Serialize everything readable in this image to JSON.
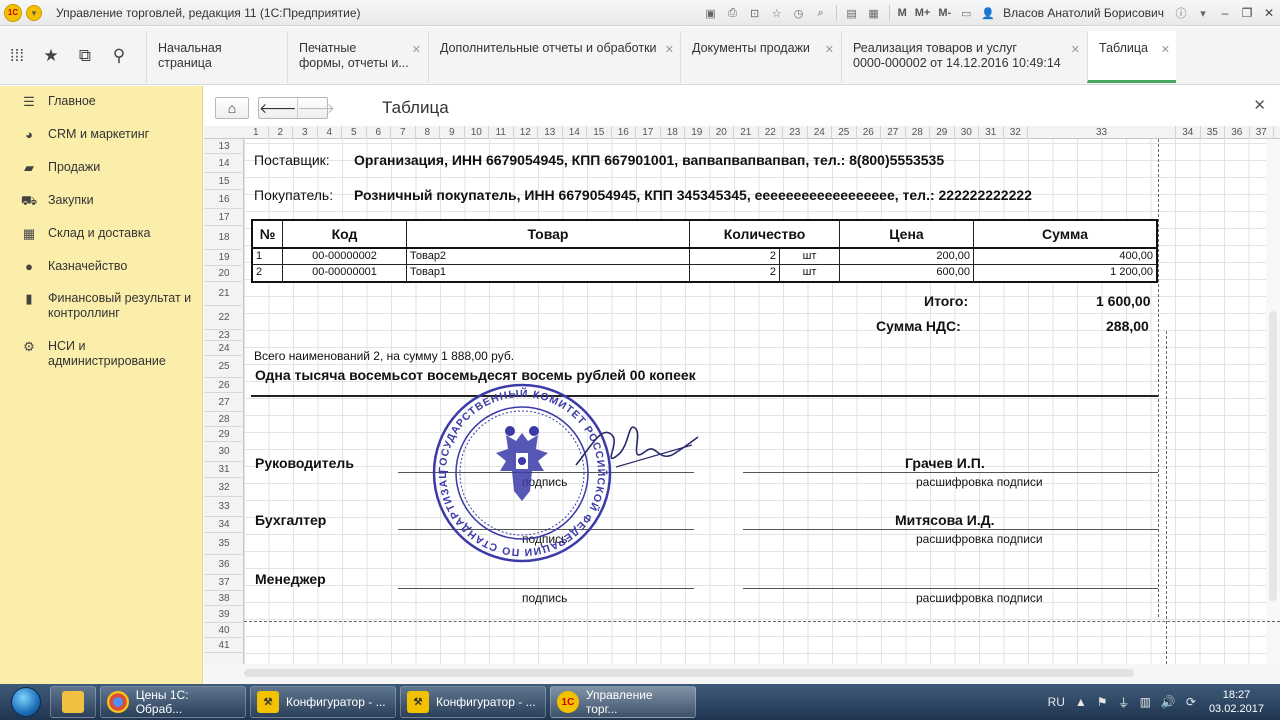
{
  "titlebar": {
    "logo_text": "1С",
    "app_title": "Управление торговлей, редакция 11  (1С:Предприятие)",
    "m_label": "M",
    "mplus_label": "M+",
    "mminus_label": "M-",
    "user_name": "Власов Анатолий Борисович"
  },
  "tabs": [
    {
      "line1": "Начальная страница",
      "line2": ""
    },
    {
      "line1": "Печатные",
      "line2": "формы, отчеты и..."
    },
    {
      "line1": "Дополнительные отчеты и обработки",
      "line2": ""
    },
    {
      "line1": "Документы продажи",
      "line2": ""
    },
    {
      "line1": "Реализация товаров и услуг",
      "line2": "0000-000002 от 14.12.2016 10:49:14"
    },
    {
      "line1": "Таблица",
      "line2": ""
    }
  ],
  "sidebar": {
    "items": [
      {
        "label": "Главное",
        "icon": "menu-lines-icon"
      },
      {
        "label": "CRM и маркетинг",
        "icon": "pie-chart-icon"
      },
      {
        "label": "Продажи",
        "icon": "shopping-bag-icon"
      },
      {
        "label": "Закупки",
        "icon": "shopping-cart-icon"
      },
      {
        "label": "Склад и доставка",
        "icon": "warehouse-grid-icon"
      },
      {
        "label": "Казначейство",
        "icon": "coin-icon"
      },
      {
        "label": "Финансовый результат и контроллинг",
        "icon": "bar-chart-icon"
      },
      {
        "label": "НСИ и администрирование",
        "icon": "gear-icon"
      }
    ]
  },
  "content": {
    "title": "Таблица"
  },
  "sheet": {
    "col_headers": [
      "1",
      "2",
      "3",
      "4",
      "5",
      "6",
      "7",
      "8",
      "9",
      "10",
      "11",
      "12",
      "13",
      "14",
      "15",
      "16",
      "17",
      "18",
      "19",
      "20",
      "21",
      "22",
      "23",
      "24",
      "25",
      "26",
      "27",
      "28",
      "29",
      "30",
      "31",
      "32",
      "33",
      "34",
      "35",
      "36",
      "37"
    ],
    "row_headers": [
      "13",
      "14",
      "15",
      "16",
      "17",
      "18",
      "19",
      "20",
      "21",
      "22",
      "23",
      "24",
      "25",
      "26",
      "27",
      "28",
      "29",
      "30",
      "31",
      "32",
      "33",
      "34",
      "35",
      "36",
      "37",
      "38",
      "39",
      "40",
      "41"
    ]
  },
  "document": {
    "supplier_label": "Поставщик:",
    "supplier_value": "Организация, ИНН 6679054945, КПП 667901001, вапвапвапвапвап, тел.: 8(800)5553535",
    "buyer_label": "Покупатель:",
    "buyer_value": "Розничный покупатель, ИНН 6679054945, КПП 345345345, ееееееееееееееееее, тел.: 222222222222",
    "table": {
      "headers": [
        "№",
        "Код",
        "Товар",
        "Количество",
        "Цена",
        "Сумма"
      ],
      "rows": [
        {
          "n": "1",
          "code": "00-00000002",
          "item": "Товар2",
          "qty": "2",
          "unit": "шт",
          "price": "200,00",
          "sum": "400,00"
        },
        {
          "n": "2",
          "code": "00-00000001",
          "item": "Товар1",
          "qty": "2",
          "unit": "шт",
          "price": "600,00",
          "sum": "1 200,00"
        }
      ]
    },
    "total_label": "Итого:",
    "total_value": "1 600,00",
    "vat_label": "Сумма НДС:",
    "vat_value": "288,00",
    "items_summary": "Всего наименований 2, на сумму 1 888,00 руб.",
    "amount_words": "Одна тысяча восемьсот восемьдесят восемь рублей 00 копеек",
    "signatures": {
      "director_label": "Руководитель",
      "director_name": "Грачев И.П.",
      "accountant_label": "Бухгалтер",
      "accountant_name": "Митясова И.Д.",
      "manager_label": "Менеджер",
      "signature_caption": "подпись",
      "decoding_caption": "расшифровка подписи"
    },
    "stamp_text": "ГОСУДАРСТВЕННЫЙ КОМИТЕТ РОССИЙСКОЙ ФЕДЕРАЦИИ ПО СТАНДАРТИЗАЦИИ И МЕТРОЛОГИИ (ГОССТАНДАРТ РОССИИ)"
  },
  "taskbar": {
    "apps": [
      {
        "label": "Цены 1С: Обраб...",
        "icon": "chrome-icon"
      },
      {
        "label": "Конфигуратор - ...",
        "icon": "configurator-icon"
      },
      {
        "label": "Конфигуратор - ...",
        "icon": "configurator-icon"
      },
      {
        "label": "Управление торг...",
        "icon": "1c-icon"
      }
    ],
    "lang": "RU",
    "time": "18:27",
    "date": "03.02.2017"
  },
  "colors": {
    "sidebar_bg": "#fbeeaa",
    "active_tab_underline": "#4aa862",
    "stamp": "#3a3aa8"
  }
}
